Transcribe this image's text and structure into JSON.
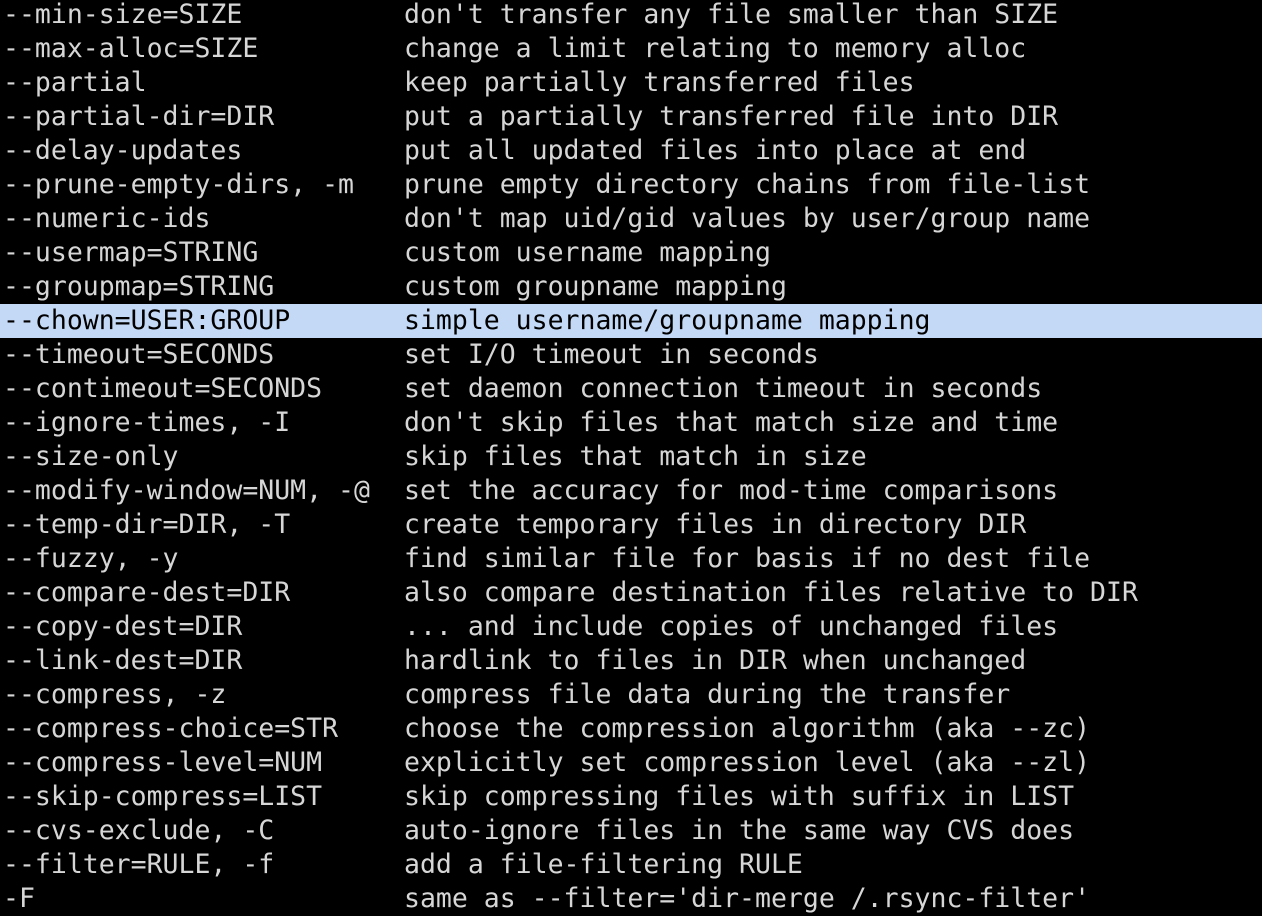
{
  "terminal": {
    "selected_index": 9,
    "colors": {
      "background": "#000000",
      "text": "#d6d6d6",
      "selection_background": "#c4d9f6",
      "selection_text": "#000000"
    },
    "lines": [
      {
        "option": "--min-size=SIZE",
        "description": "don't transfer any file smaller than SIZE"
      },
      {
        "option": "--max-alloc=SIZE",
        "description": "change a limit relating to memory alloc"
      },
      {
        "option": "--partial",
        "description": "keep partially transferred files"
      },
      {
        "option": "--partial-dir=DIR",
        "description": "put a partially transferred file into DIR"
      },
      {
        "option": "--delay-updates",
        "description": "put all updated files into place at end"
      },
      {
        "option": "--prune-empty-dirs, -m",
        "description": "prune empty directory chains from file-list"
      },
      {
        "option": "--numeric-ids",
        "description": "don't map uid/gid values by user/group name"
      },
      {
        "option": "--usermap=STRING",
        "description": "custom username mapping"
      },
      {
        "option": "--groupmap=STRING",
        "description": "custom groupname mapping"
      },
      {
        "option": "--chown=USER:GROUP",
        "description": "simple username/groupname mapping"
      },
      {
        "option": "--timeout=SECONDS",
        "description": "set I/O timeout in seconds"
      },
      {
        "option": "--contimeout=SECONDS",
        "description": "set daemon connection timeout in seconds"
      },
      {
        "option": "--ignore-times, -I",
        "description": "don't skip files that match size and time"
      },
      {
        "option": "--size-only",
        "description": "skip files that match in size"
      },
      {
        "option": "--modify-window=NUM, -@",
        "description": "set the accuracy for mod-time comparisons"
      },
      {
        "option": "--temp-dir=DIR, -T",
        "description": "create temporary files in directory DIR"
      },
      {
        "option": "--fuzzy, -y",
        "description": "find similar file for basis if no dest file"
      },
      {
        "option": "--compare-dest=DIR",
        "description": "also compare destination files relative to DIR"
      },
      {
        "option": "--copy-dest=DIR",
        "description": "... and include copies of unchanged files"
      },
      {
        "option": "--link-dest=DIR",
        "description": "hardlink to files in DIR when unchanged"
      },
      {
        "option": "--compress, -z",
        "description": "compress file data during the transfer"
      },
      {
        "option": "--compress-choice=STR",
        "description": "choose the compression algorithm (aka --zc)"
      },
      {
        "option": "--compress-level=NUM",
        "description": "explicitly set compression level (aka --zl)"
      },
      {
        "option": "--skip-compress=LIST",
        "description": "skip compressing files with suffix in LIST"
      },
      {
        "option": "--cvs-exclude, -C",
        "description": "auto-ignore files in the same way CVS does"
      },
      {
        "option": "--filter=RULE, -f",
        "description": "add a file-filtering RULE"
      },
      {
        "option": "-F",
        "description": "same as --filter='dir-merge /.rsync-filter'"
      }
    ]
  }
}
